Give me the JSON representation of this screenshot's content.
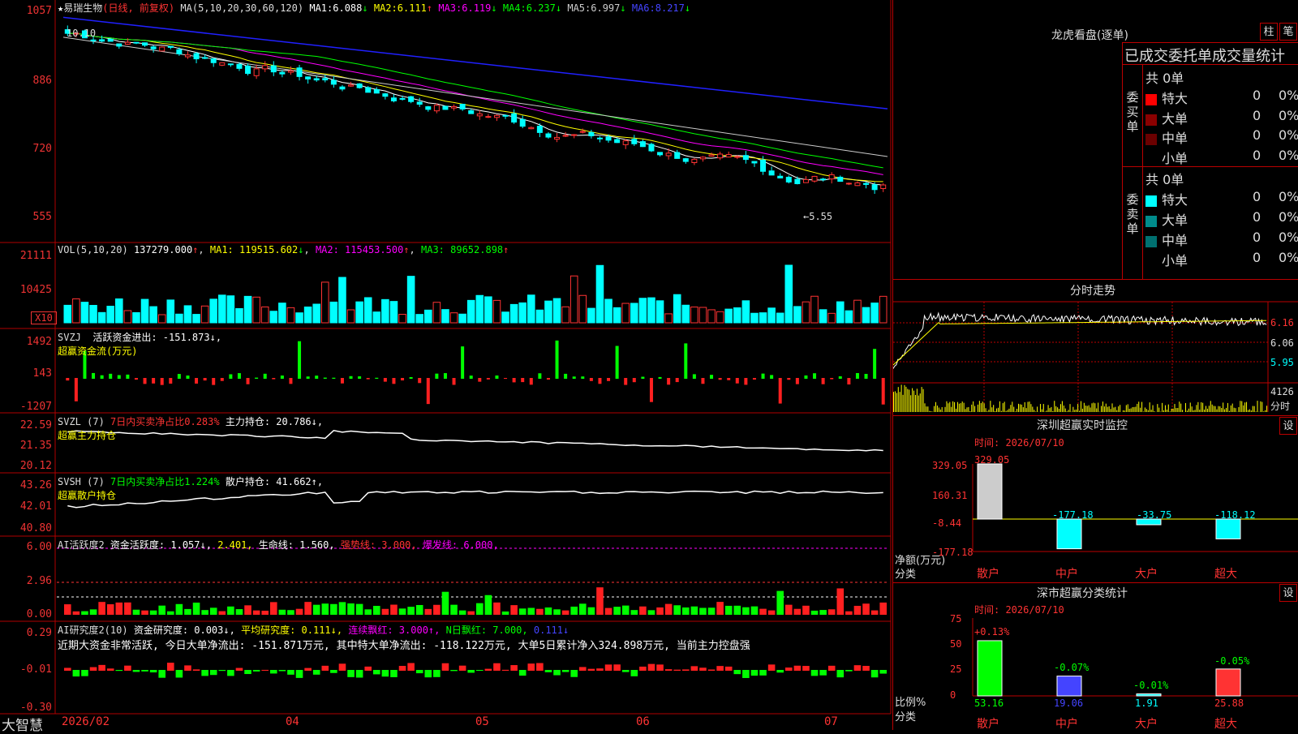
{
  "stock": {
    "title": "易瑞生物",
    "mode": "(日线, 前复权)",
    "ma_label": "MA(5,10,20,30,60,120)",
    "ma": [
      {
        "name": "MA1:",
        "value": "6.088",
        "arrow": "↓",
        "color": "#ffffff"
      },
      {
        "name": "MA2:",
        "value": "6.111",
        "arrow": "↑",
        "color": "#ffff00"
      },
      {
        "name": "MA3:",
        "value": "6.119",
        "arrow": "↓",
        "color": "#ff00ff"
      },
      {
        "name": "MA4:",
        "value": "6.237",
        "arrow": "↓",
        "color": "#00ff00"
      },
      {
        "name": "MA5:",
        "value": "6.997",
        "arrow": "↓",
        "color": "#cccccc"
      },
      {
        "name": "MA6:",
        "value": "8.217",
        "arrow": "↓",
        "color": "#2020ff"
      }
    ],
    "high_mark": "10.10",
    "low_mark": "←5.55",
    "price_ticks": [
      "1057",
      "886",
      "720",
      "555"
    ],
    "colors": {
      "up": "#ff3333",
      "down": "#00ffff",
      "border": "#b00000"
    }
  },
  "vol": {
    "label": "VOL(5,10,20)",
    "value": "137279.000",
    "arrow": "↑",
    "ma": [
      {
        "t": "MA1: 119515.602",
        "a": "↓",
        "c": "#ffff00"
      },
      {
        "t": "MA2: 115453.500",
        "a": "↑",
        "c": "#ff00ff"
      },
      {
        "t": "MA3: 89652.898",
        "a": "↑",
        "c": "#00ff00"
      }
    ],
    "ticks": [
      "21111",
      "10425"
    ],
    "unit": "X10"
  },
  "svzj": {
    "label": "SVZJ",
    "desc": "活跃资金进出: -151.873↓,",
    "sub": "超赢资金流(万元)",
    "ticks": [
      "1492",
      "143",
      "-1207"
    ]
  },
  "svzl": {
    "label": "SVZL (7)",
    "desc": "7日内买卖净占比0.283%",
    "desc2": "主力持仓: 20.786↓,",
    "sub": "超赢主力持仓",
    "ticks": [
      "22.59",
      "21.35",
      "20.12"
    ]
  },
  "svsh": {
    "label": "SVSH (7)",
    "desc": "7日内买卖净占比1.224%",
    "desc2": "散户持仓: 41.662↑,",
    "sub": "超赢散户持仓",
    "ticks": [
      "43.26",
      "42.01",
      "40.80"
    ]
  },
  "ai1": {
    "label": "AI活跃度2",
    "desc": "资金活跃度: 1.057↓,",
    "v2": "2.401,",
    "life": "生命线: 1.560,",
    "strong": "强势线: 3.000,",
    "burst": "爆发线: 6.000,",
    "ticks": [
      "6.00",
      "2.96",
      "0.00"
    ]
  },
  "ai2": {
    "label": "AI研究度2(10)",
    "desc": "资金研究度: 0.003↓,",
    "avg": "平均研究度: 0.111↓,",
    "cont": "连续飘红: 3.000↑,",
    "nday": "N日飘红: 7.000,",
    "extra": "0.111↓",
    "note": "近期大资金非常活跃, 今日大单净流出: -151.871万元, 其中特大单净流出: -118.122万元, 大单5日累计净入324.898万元, 当前主力控盘强",
    "ticks": [
      "0.29",
      "-0.01",
      "-0.30"
    ]
  },
  "xaxis": {
    "brand": "大智慧",
    "labels": [
      "2026/02",
      "04",
      "05",
      "06",
      "07"
    ]
  },
  "panel": {
    "longhu": "龙虎看盘(逐单)",
    "btn1": "柱",
    "btn2": "笔",
    "stat_title": "已成交委托单成交量统计",
    "buy": {
      "side": "委买单",
      "total": "共 0单",
      "rows": [
        {
          "name": "特大",
          "v": "0",
          "p": "0%",
          "c": "#ff0000"
        },
        {
          "name": "大单",
          "v": "0",
          "p": "0%",
          "c": "#8b0000"
        },
        {
          "name": "中单",
          "v": "0",
          "p": "0%",
          "c": "#6b0000"
        },
        {
          "name": "小单",
          "v": "0",
          "p": "0%",
          "c": "#000000"
        }
      ]
    },
    "sell": {
      "side": "委卖单",
      "total": "共 0单",
      "rows": [
        {
          "name": "特大",
          "v": "0",
          "p": "0%",
          "c": "#00ffff"
        },
        {
          "name": "大单",
          "v": "0",
          "p": "0%",
          "c": "#008b8b"
        },
        {
          "name": "中单",
          "v": "0",
          "p": "0%",
          "c": "#007070"
        },
        {
          "name": "小单",
          "v": "0",
          "p": "0%",
          "c": "#000000"
        }
      ]
    },
    "intraday": {
      "title": "分时走势",
      "ticks": [
        "6.16",
        "6.06",
        "5.95"
      ],
      "vol": "4126",
      "vol_lbl": "分时"
    },
    "monitor": {
      "title": "深圳超赢实时监控",
      "btn": "设",
      "time": "时间: 2026/07/10",
      "ticks": [
        "329.05",
        "160.31",
        "-8.44",
        "-177.18"
      ],
      "ylab": "净额(万元)",
      "xlab": "分类",
      "bars": [
        {
          "cat": "散户",
          "v": "329.05"
        },
        {
          "cat": "中户",
          "v": "-177.18"
        },
        {
          "cat": "大户",
          "v": "-33.75"
        },
        {
          "cat": "超大",
          "v": "-118.12"
        }
      ]
    },
    "stats": {
      "title": "深市超赢分类统计",
      "btn": "设",
      "time": "时间: 2026/07/10",
      "ticks": [
        "75",
        "50",
        "25",
        "0"
      ],
      "ylab": "比例%",
      "xlab": "分类",
      "bars": [
        {
          "cat": "散户",
          "v": "53.16",
          "d": "+0.13%"
        },
        {
          "cat": "中户",
          "v": "19.06",
          "d": "-0.07%"
        },
        {
          "cat": "大户",
          "v": "1.91",
          "d": "-0.01%"
        },
        {
          "cat": "超大",
          "v": "25.88",
          "d": "-0.05%"
        }
      ]
    }
  },
  "chart_data": {
    "type": "candlestick",
    "title": "易瑞生物",
    "ylim": [
      5.55,
      10.57
    ],
    "y_ticks": [
      10.57,
      8.86,
      7.2,
      5.55
    ],
    "high": 10.1,
    "low": 5.55,
    "x_labels": [
      "2026/02",
      "04",
      "05",
      "06",
      "07"
    ]
  }
}
